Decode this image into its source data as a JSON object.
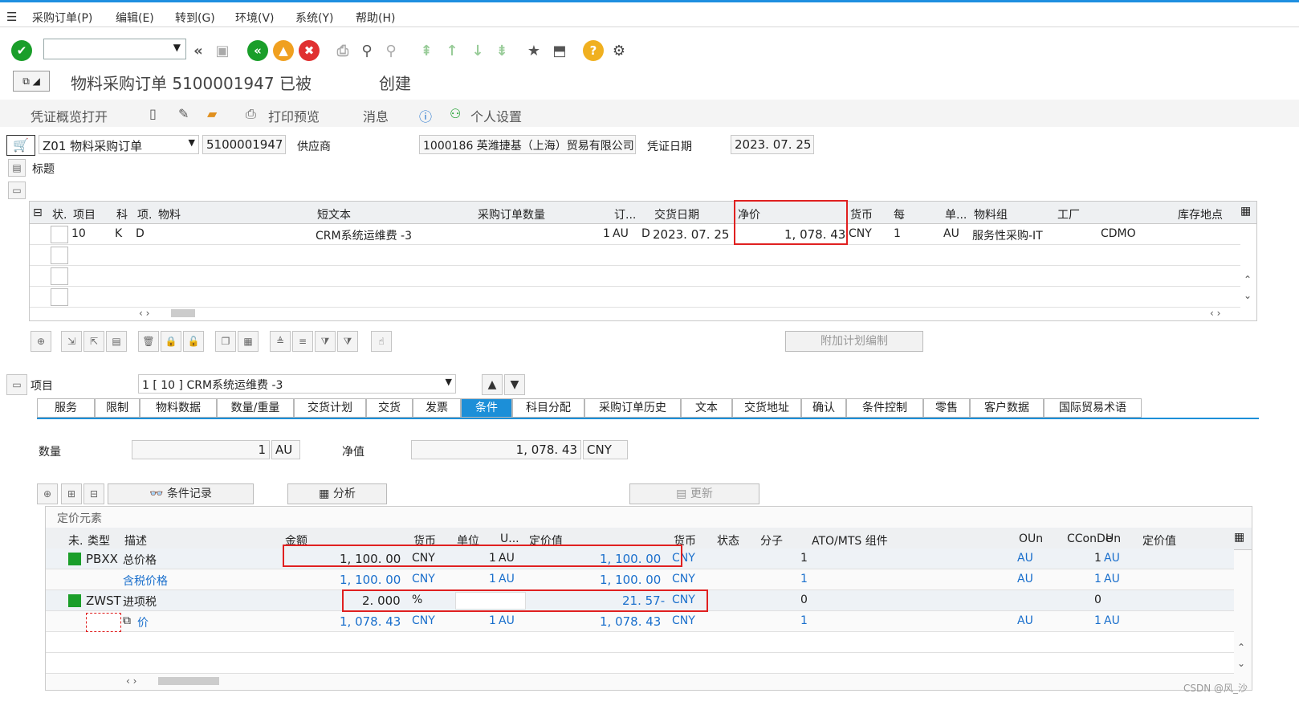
{
  "menu": [
    "采购订单(P)",
    "编辑(E)",
    "转到(G)",
    "环境(V)",
    "系统(Y)",
    "帮助(H)"
  ],
  "title": "物料采购订单 5100001947 已被",
  "title_suffix": "创建",
  "appbar": {
    "doc_overview": "凭证概览打开",
    "print_preview": "打印预览",
    "messages": "消息",
    "personal_settings": "个人设置"
  },
  "header": {
    "doc_type": "Z01 物料采购订单",
    "po_number": "5100001947",
    "vendor_label": "供应商",
    "vendor_value": "1000186 英潍捷基（上海）贸易有限公司",
    "doc_date_label": "凭证日期",
    "doc_date_value": "2023. 07. 25",
    "header_label": "标题"
  },
  "items_grid": {
    "columns": [
      "状.",
      "项目",
      "科",
      "项.",
      "物料",
      "短文本",
      "采购订单数量",
      "订...",
      "交货日期",
      "净价",
      "货币",
      "每",
      "单...",
      "物料组",
      "工厂",
      "库存地点"
    ],
    "row": {
      "item": "10",
      "acct": "K",
      "cat": "D",
      "short_text": "CRM系统运维费 -3",
      "qty": "1",
      "unit": "AU",
      "d": "D",
      "delivery_date": "2023. 07. 25",
      "net_price": "1, 078. 43",
      "currency": "CNY",
      "per": "1",
      "uom": "AU",
      "mat_group": "服务性采购-IT",
      "plant": "CDMO"
    }
  },
  "additional_schedule_btn": "附加计划编制",
  "item_detail": {
    "label": "项目",
    "selected": "1 [ 10 ] CRM系统运维费 -3"
  },
  "tabs": [
    "服务",
    "限制",
    "物料数据",
    "数量/重量",
    "交货计划",
    "交货",
    "发票",
    "条件",
    "科目分配",
    "采购订单历史",
    "文本",
    "交货地址",
    "确认",
    "条件控制",
    "零售",
    "客户数据",
    "国际贸易术语"
  ],
  "active_tab": "条件",
  "conditions": {
    "qty_label": "数量",
    "qty_value": "1",
    "qty_unit": "AU",
    "net_label": "净值",
    "net_value": "1, 078. 43",
    "net_currency": "CNY",
    "cond_record_btn": "条件记录",
    "analysis_btn": "分析",
    "update_btn": "更新",
    "section_title": "定价元素"
  },
  "pricing_grid": {
    "columns": [
      "未.",
      "类型",
      "描述",
      "金额",
      "货币",
      "单位",
      "U...",
      "定价值",
      "货币",
      "状态",
      "分子",
      "ATO/MTS 组件",
      "OUn",
      "CConDe",
      "Un",
      "定价值"
    ],
    "rows": [
      {
        "type": "PBXX",
        "desc": "总价格",
        "amount": "1, 100. 00",
        "cur": "CNY",
        "unit": "1",
        "u": "AU",
        "value": "1, 100. 00",
        "vcur": "CNY",
        "num": "1",
        "oun": "AU",
        "ccon": "1",
        "un": "AU"
      },
      {
        "type": "",
        "desc": "含税价格",
        "amount": "1, 100. 00",
        "cur": "CNY",
        "unit": "1",
        "u": "AU",
        "value": "1, 100. 00",
        "vcur": "CNY",
        "num": "1",
        "oun": "AU",
        "ccon": "1",
        "un": "AU"
      },
      {
        "type": "ZWST",
        "desc": "进项税",
        "amount": "2. 000",
        "cur": "%",
        "unit": "",
        "u": "",
        "value": "21. 57-",
        "vcur": "CNY",
        "num": "0",
        "oun": "",
        "ccon": "0",
        "un": ""
      },
      {
        "type": "",
        "desc": "价",
        "amount": "1, 078. 43",
        "cur": "CNY",
        "unit": "1",
        "u": "AU",
        "value": "1, 078. 43",
        "vcur": "CNY",
        "num": "1",
        "oun": "AU",
        "ccon": "1",
        "un": "AU"
      }
    ]
  },
  "watermark": "CSDN @风_沙",
  "colors": {
    "accent": "#1c8fd8",
    "highlight": "#e02020",
    "link": "#1a6fcc"
  }
}
